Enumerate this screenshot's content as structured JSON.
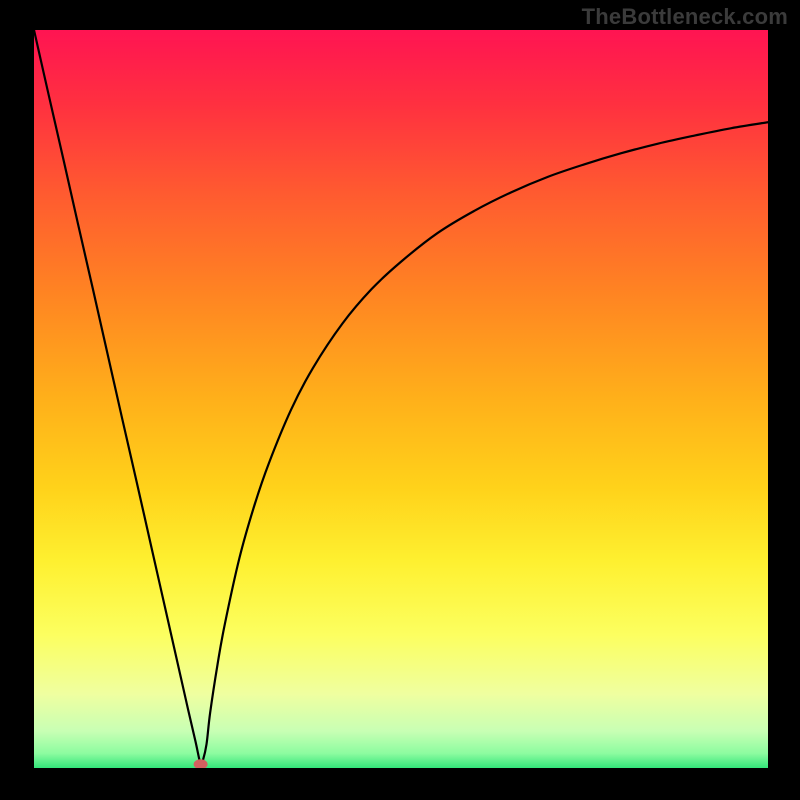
{
  "watermark": "TheBottleneck.com",
  "chart_data": {
    "type": "line",
    "title": "",
    "xlabel": "",
    "ylabel": "",
    "xlim": [
      0,
      100
    ],
    "ylim": [
      0,
      100
    ],
    "grid": false,
    "x": [
      0,
      2,
      4,
      6,
      8,
      10,
      12,
      14,
      16,
      18,
      20,
      21,
      22,
      22.7,
      23,
      23.5,
      24,
      25,
      26,
      28,
      30,
      32,
      35,
      38,
      42,
      46,
      50,
      55,
      60,
      65,
      70,
      75,
      80,
      85,
      90,
      95,
      100
    ],
    "values": [
      100,
      91.2,
      82.5,
      73.7,
      65.0,
      56.2,
      47.4,
      38.7,
      29.9,
      21.1,
      12.3,
      7.9,
      3.6,
      0.5,
      1.0,
      3.2,
      7.5,
      14.0,
      19.5,
      28.5,
      35.5,
      41.3,
      48.5,
      54.2,
      60.2,
      64.9,
      68.6,
      72.5,
      75.5,
      78.0,
      80.1,
      81.8,
      83.3,
      84.6,
      85.7,
      86.7,
      87.5
    ],
    "marker": {
      "x": 22.7,
      "y": 0.5,
      "color": "#d36060",
      "size": 6
    },
    "gradient_stops": [
      {
        "offset": 0.0,
        "color": "#ff1452"
      },
      {
        "offset": 0.1,
        "color": "#ff3040"
      },
      {
        "offset": 0.22,
        "color": "#ff5a30"
      },
      {
        "offset": 0.36,
        "color": "#ff8522"
      },
      {
        "offset": 0.5,
        "color": "#ffb01a"
      },
      {
        "offset": 0.62,
        "color": "#ffd21a"
      },
      {
        "offset": 0.72,
        "color": "#fef030"
      },
      {
        "offset": 0.82,
        "color": "#fcff60"
      },
      {
        "offset": 0.9,
        "color": "#efffa0"
      },
      {
        "offset": 0.95,
        "color": "#c8ffb4"
      },
      {
        "offset": 0.98,
        "color": "#8dfca0"
      },
      {
        "offset": 1.0,
        "color": "#34e57a"
      }
    ]
  }
}
